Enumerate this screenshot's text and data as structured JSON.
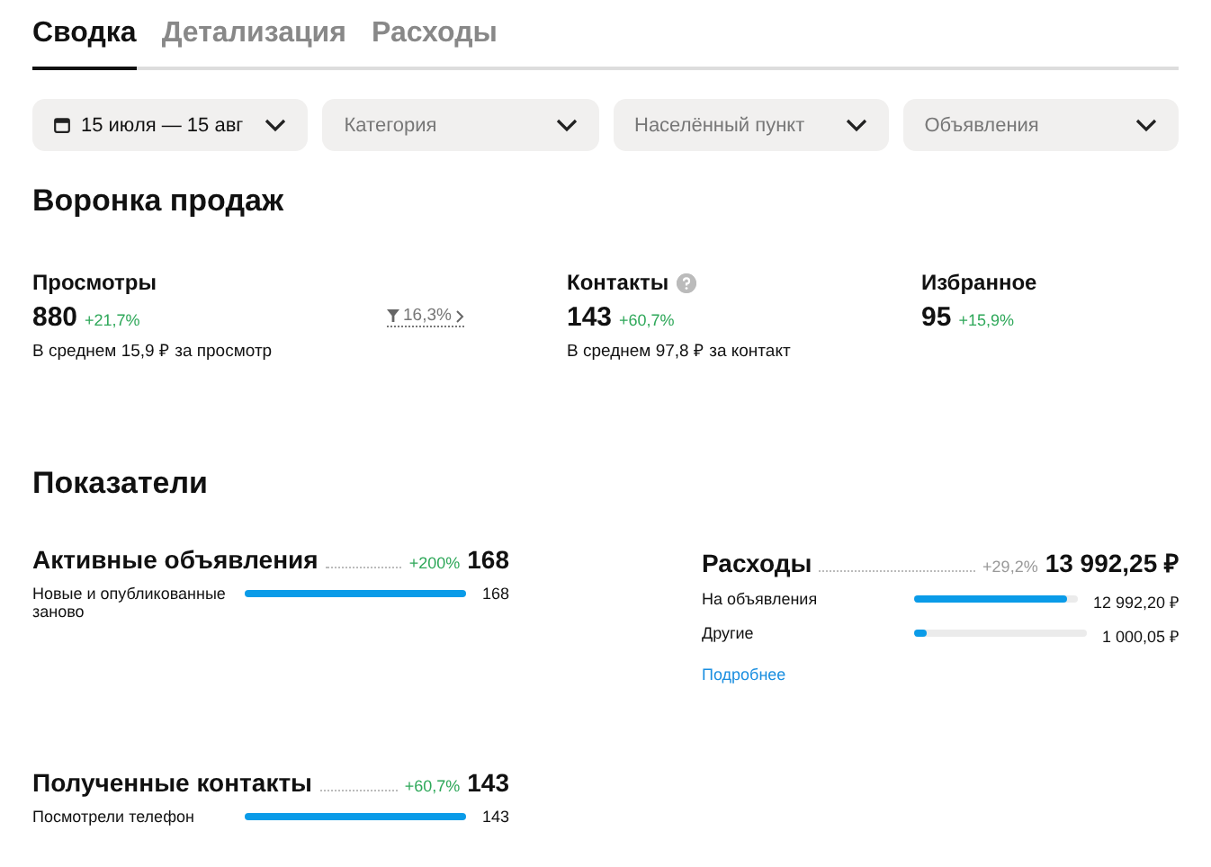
{
  "tabs": [
    {
      "label": "Сводка",
      "selected": true
    },
    {
      "label": "Детализация",
      "selected": false
    },
    {
      "label": "Расходы",
      "selected": false
    }
  ],
  "filters": [
    {
      "label": "15 июля — 15 авг",
      "kind": "date",
      "placeholder": false
    },
    {
      "label": "Категория",
      "kind": "select",
      "placeholder": true
    },
    {
      "label": "Населённый пункт",
      "kind": "select",
      "placeholder": true
    },
    {
      "label": "Объявления",
      "kind": "select",
      "placeholder": true
    }
  ],
  "funnel": {
    "title": "Воронка продаж",
    "conversion": "16,3%",
    "stages": [
      {
        "label": "Просмотры",
        "value": "880",
        "delta": "+21,7%",
        "note": "В среднем 15,9 ₽ за просмотр",
        "help": false
      },
      {
        "label": "Контакты",
        "value": "143",
        "delta": "+60,7%",
        "note": "В среднем 97,8 ₽ за контакт",
        "help": true
      },
      {
        "label": "Избранное",
        "value": "95",
        "delta": "+15,9%",
        "help": false
      }
    ]
  },
  "indicators": {
    "title": "Показатели",
    "blocks": [
      {
        "title": "Активные объявления",
        "delta": "+200%",
        "kind": "positive",
        "total": "168",
        "rows": [
          {
            "label": "Новые и опубликованные заново",
            "level": 1,
            "value": "168"
          }
        ]
      },
      {
        "title": "Расходы",
        "delta": "+29,2%",
        "kind": "neutral",
        "total": "13 992,25 ₽",
        "rows": [
          {
            "label": "На объявления",
            "level": 0.93,
            "value": "12 992,20 ₽"
          },
          {
            "label": "Другие",
            "level": 0.07,
            "value": "1 000,05 ₽"
          }
        ],
        "link": "Подробнее"
      },
      {
        "title": "Полученные контакты",
        "delta": "+60,7%",
        "kind": "positive",
        "total": "143",
        "rows": [
          {
            "label": "Посмотрели телефон",
            "level": 1,
            "value": "143"
          }
        ]
      }
    ]
  }
}
